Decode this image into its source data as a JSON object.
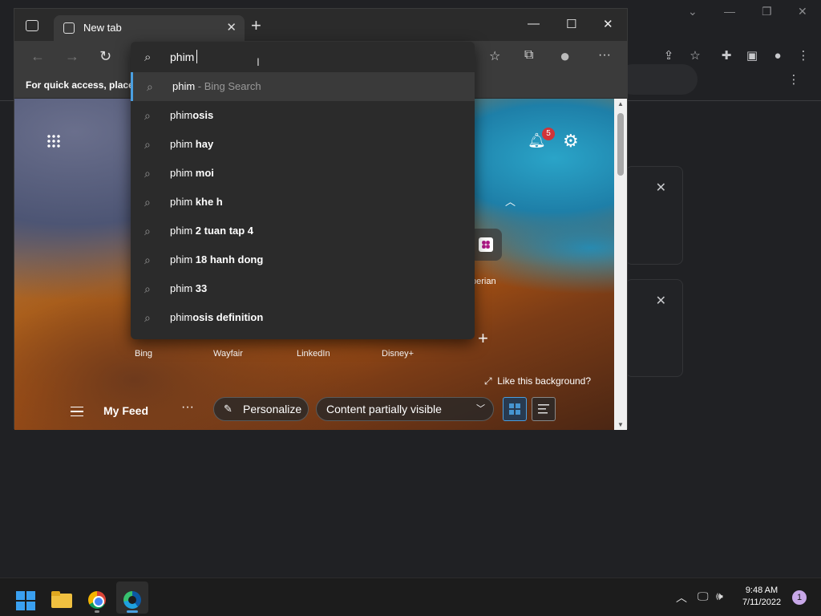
{
  "edge": {
    "tab_title": "New tab",
    "bookmark_hint": "For quick access, place y",
    "search_value": "phim",
    "suggestions": [
      {
        "prefix": "phim",
        "bold": "",
        "sub": " - Bing Search"
      },
      {
        "prefix": "phim",
        "bold": "osis",
        "sub": ""
      },
      {
        "prefix": "phim ",
        "bold": "hay",
        "sub": ""
      },
      {
        "prefix": "phim ",
        "bold": "moi",
        "sub": ""
      },
      {
        "prefix": "phim ",
        "bold": "khe h",
        "sub": ""
      },
      {
        "prefix": "phim ",
        "bold": "2 tuan tap 4",
        "sub": ""
      },
      {
        "prefix": "phim ",
        "bold": "18 hanh dong",
        "sub": ""
      },
      {
        "prefix": "phim ",
        "bold": "33",
        "sub": ""
      },
      {
        "prefix": "phim",
        "bold": "osis definition",
        "sub": ""
      }
    ],
    "notification_count": "5",
    "experian_label": "perian",
    "quick_links": [
      "Bing",
      "Wayfair",
      "LinkedIn",
      "Disney+"
    ],
    "like_background": "Like this background?",
    "feed": {
      "my_feed": "My Feed",
      "more": "···",
      "personalize": "Personalize",
      "content_visibility": "Content partially visible"
    }
  },
  "taskbar": {
    "time": "9:48 AM",
    "date": "7/11/2022",
    "notification_count": "1"
  },
  "colors": {
    "accent": "#4a9fe0",
    "badge": "#d13438"
  }
}
